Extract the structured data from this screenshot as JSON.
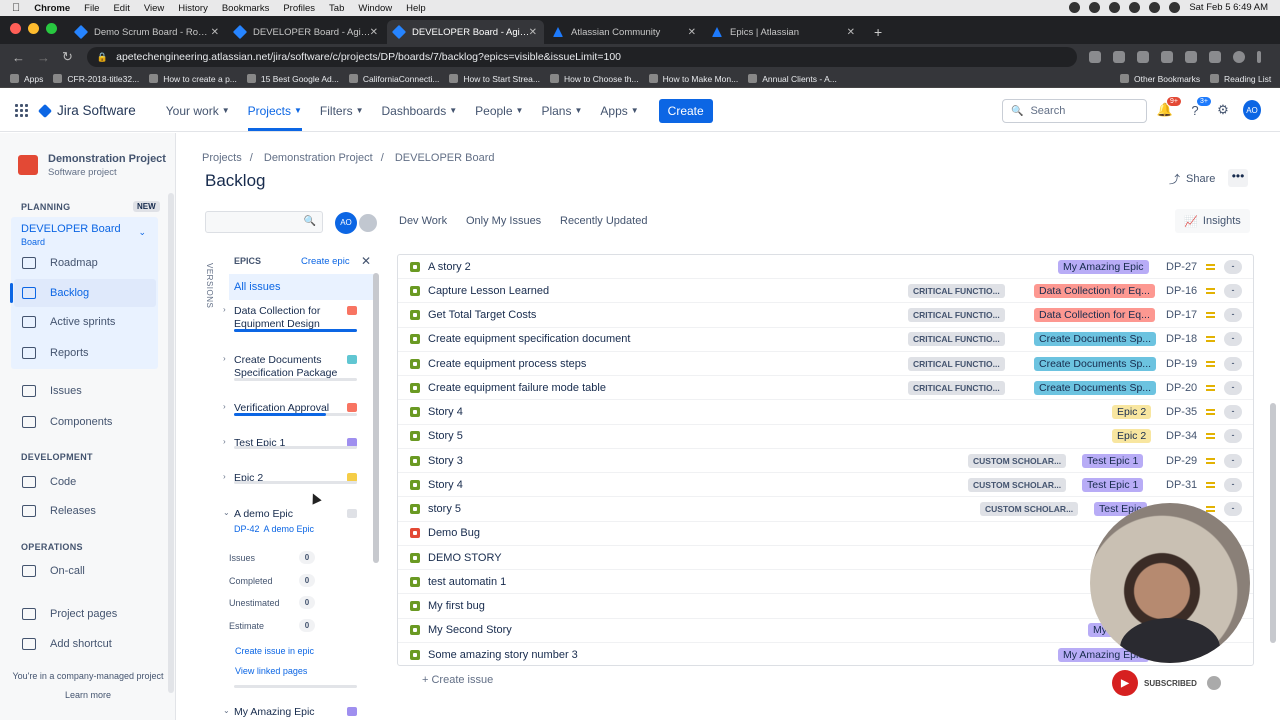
{
  "mac": {
    "app": "Chrome",
    "menus": [
      "File",
      "Edit",
      "View",
      "History",
      "Bookmarks",
      "Profiles",
      "Tab",
      "Window",
      "Help"
    ],
    "clock": "Sat Feb 5  6:49 AM"
  },
  "browser": {
    "tabs": [
      {
        "title": "Demo Scrum Board - Roadmap"
      },
      {
        "title": "DEVELOPER Board - Agile Board"
      },
      {
        "title": "DEVELOPER Board - Agile Board"
      },
      {
        "title": "Atlassian Community"
      },
      {
        "title": "Epics | Atlassian"
      }
    ],
    "url": "apetechengineering.atlassian.net/jira/software/c/projects/DP/boards/7/backlog?epics=visible&issueLimit=100",
    "bookmarks": [
      "Apps",
      "CFR-2018-title32...",
      "How to create a p...",
      "15 Best Google Ad...",
      "CaliforniaConnecti...",
      "How to Start Strea...",
      "How to Choose th...",
      "How to Make Mon...",
      "Annual Clients - A..."
    ],
    "other_bookmarks": "Other Bookmarks",
    "reading_list": "Reading List"
  },
  "nav": {
    "product": "Jira Software",
    "items": [
      "Your work",
      "Projects",
      "Filters",
      "Dashboards",
      "People",
      "Plans",
      "Apps"
    ],
    "create": "Create",
    "search_placeholder": "Search",
    "notif_count": "9+",
    "help_count": "3+",
    "avatar": "AO"
  },
  "sidebar": {
    "project_name": "Demonstration Project",
    "project_type": "Software project",
    "planning": "PLANNING",
    "new_badge": "NEW",
    "board": "DEVELOPER Board",
    "board_type": "Board",
    "planning_items": [
      "Roadmap",
      "Backlog",
      "Active sprints",
      "Reports"
    ],
    "other_items": [
      "Issues",
      "Components"
    ],
    "development": "DEVELOPMENT",
    "dev_items": [
      "Code",
      "Releases"
    ],
    "operations": "OPERATIONS",
    "ops_items": [
      "On-call"
    ],
    "footer_items": [
      "Project pages",
      "Add shortcut"
    ],
    "managed": "You're in a company-managed project",
    "learn": "Learn more"
  },
  "main": {
    "breadcrumb": [
      "Projects",
      "Demonstration Project",
      "DEVELOPER Board"
    ],
    "title": "Backlog",
    "share": "Share",
    "insights": "Insights",
    "avatar": "AO",
    "filters": [
      "Dev Work",
      "Only My Issues",
      "Recently Updated"
    ],
    "versions": "VERSIONS",
    "create_issue": "+ Create issue"
  },
  "epics": {
    "header": "EPICS",
    "create": "Create epic",
    "all": "All issues",
    "list": [
      {
        "name": "Data Collection for Equipment Design",
        "color": "#f87462",
        "progress": 1.0
      },
      {
        "name": "Create Documents Specification Package",
        "color": "#60c6d2",
        "progress": 0
      },
      {
        "name": "Verification Approval",
        "color": "#f87462",
        "progress": 0.75
      },
      {
        "name": "Test Epic 1",
        "color": "#9f8fef",
        "progress": 0
      },
      {
        "name": "Epic 2",
        "color": "#f5cd47",
        "progress": 0
      },
      {
        "name": "A demo Epic",
        "color": "#dfe1e6",
        "progress": 0
      }
    ],
    "demo": {
      "key": "DP-42",
      "name": "A demo Epic",
      "issues": "0",
      "completed": "0",
      "unestimated": "0",
      "estimate": "0",
      "labels": {
        "issues": "Issues",
        "completed": "Completed",
        "unestimated": "Unestimated",
        "estimate": "Estimate"
      },
      "create_in_epic": "Create issue in epic",
      "view_linked": "View linked pages"
    },
    "last": {
      "name": "My Amazing Epic",
      "color": "#9f8fef"
    }
  },
  "issues": [
    {
      "summary": "A story 2",
      "type": "story",
      "label": "",
      "epic": "My Amazing Epic",
      "epic_color": "#b8acf6",
      "key": "DP-27"
    },
    {
      "summary": "Capture Lesson Learned",
      "type": "story",
      "label": "CRITICAL FUNCTIO...",
      "epic": "Data Collection for Eq...",
      "epic_color": "#fd9891",
      "key": "DP-16"
    },
    {
      "summary": "Get Total Target Costs",
      "type": "story",
      "label": "CRITICAL FUNCTIO...",
      "epic": "Data Collection for Eq...",
      "epic_color": "#fd9891",
      "key": "DP-17"
    },
    {
      "summary": "Create equipment specification document",
      "type": "story",
      "label": "CRITICAL FUNCTIO...",
      "epic": "Create Documents Sp...",
      "epic_color": "#6cc3e0",
      "key": "DP-18"
    },
    {
      "summary": "Create equipment process steps",
      "type": "story",
      "label": "CRITICAL FUNCTIO...",
      "epic": "Create Documents Sp...",
      "epic_color": "#6cc3e0",
      "key": "DP-19"
    },
    {
      "summary": "Create equipment failure mode table",
      "type": "story",
      "label": "CRITICAL FUNCTIO...",
      "epic": "Create Documents Sp...",
      "epic_color": "#6cc3e0",
      "key": "DP-20"
    },
    {
      "summary": "Story 4",
      "type": "story",
      "label": "",
      "epic": "Epic 2",
      "epic_color": "#f8e6a0",
      "key": "DP-35"
    },
    {
      "summary": "Story 5",
      "type": "story",
      "label": "",
      "epic": "Epic 2",
      "epic_color": "#f8e6a0",
      "key": "DP-34"
    },
    {
      "summary": "Story 3",
      "type": "story",
      "label": "CUSTOM SCHOLAR...",
      "epic": "Test Epic 1",
      "epic_color": "#b8acf6",
      "key": "DP-29"
    },
    {
      "summary": "Story 4",
      "type": "story",
      "label": "CUSTOM SCHOLAR...",
      "epic": "Test Epic 1",
      "epic_color": "#b8acf6",
      "key": "DP-31"
    },
    {
      "summary": "story 5",
      "type": "story",
      "label": "CUSTOM SCHOLAR...",
      "epic": "Test Epic",
      "epic_color": "#b8acf6",
      "key": ""
    },
    {
      "summary": "Demo Bug",
      "type": "bug",
      "label": "",
      "epic": "",
      "epic_color": "",
      "key": ""
    },
    {
      "summary": "DEMO STORY",
      "type": "story",
      "label": "",
      "epic": "",
      "epic_color": "",
      "key": ""
    },
    {
      "summary": "test automatin 1",
      "type": "story",
      "label": "",
      "epic": "",
      "epic_color": "",
      "key": ""
    },
    {
      "summary": "My first bug",
      "type": "story",
      "label": "",
      "epic": "My Amazi",
      "epic_color": "#b8acf6",
      "key": ""
    },
    {
      "summary": "My Second Story",
      "type": "story",
      "label": "",
      "epic": "My Amazing",
      "epic_color": "#b8acf6",
      "key": ""
    },
    {
      "summary": "Some amazing story number 3",
      "type": "story",
      "label": "",
      "epic": "My Amazing Epic",
      "epic_color": "#b8acf6",
      "key": ""
    }
  ],
  "colors": {
    "story": "#6a9a23",
    "bug": "#e34935",
    "accent": "#0c66e4"
  },
  "overlay": {
    "subscribed": "SUBSCRIBED"
  }
}
